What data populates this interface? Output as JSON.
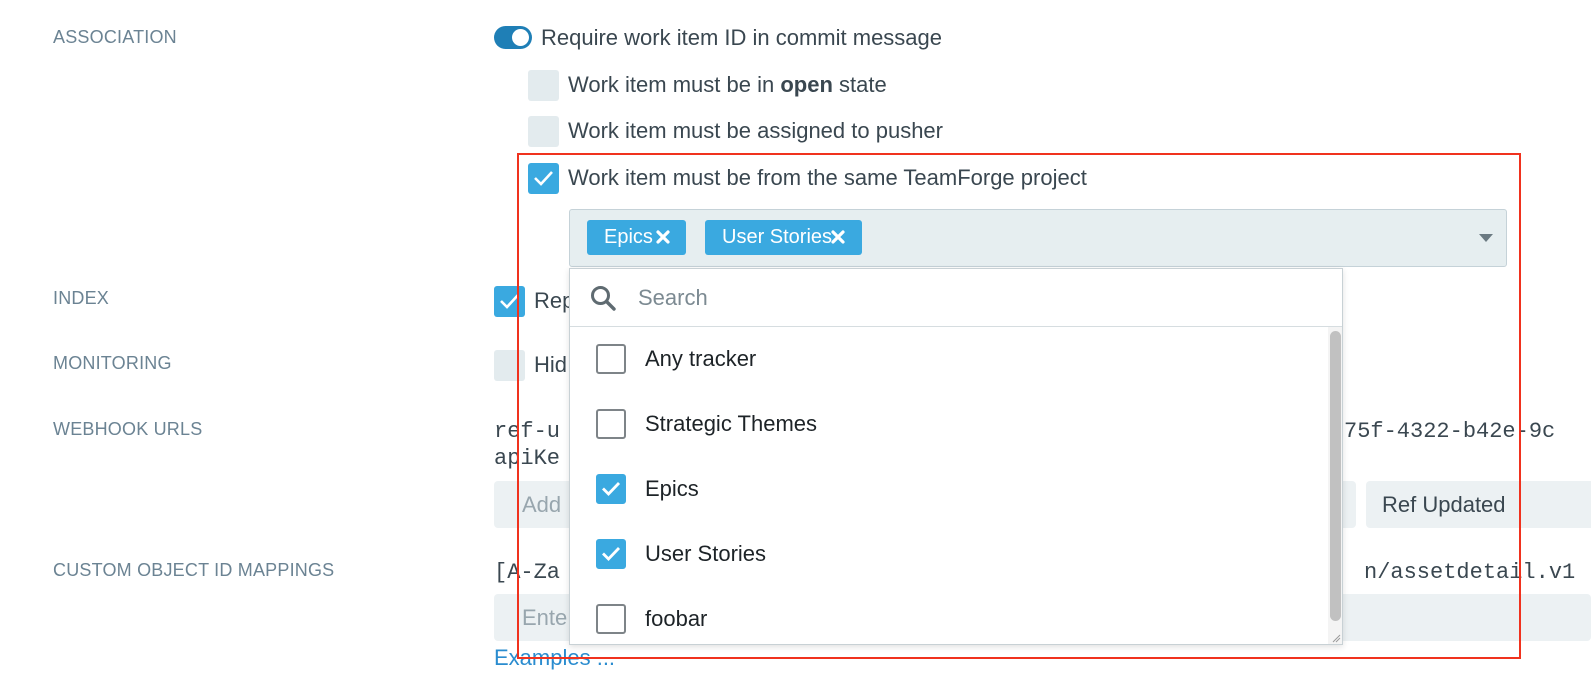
{
  "sections": {
    "association": "ASSOCIATION",
    "index": "INDEX",
    "monitoring": "MONITORING",
    "webhook_urls": "WEBHOOK URLS",
    "custom_mappings": "CUSTOM OBJECT ID MAPPINGS"
  },
  "association": {
    "require_id_toggle_on": true,
    "require_id_label": "Require work item ID in commit message",
    "open_state": {
      "checked": false,
      "prefix": "Work item must be in ",
      "bold": "open",
      "suffix": " state"
    },
    "assigned_to_pusher": {
      "checked": false,
      "label": "Work item must be assigned to pusher"
    },
    "same_project": {
      "checked": true,
      "label": "Work item must be from the same TeamForge project"
    }
  },
  "tracker_select": {
    "selected_tags": [
      "Epics",
      "User Stories"
    ],
    "search_placeholder": "Search",
    "options": [
      {
        "label": "Any tracker",
        "checked": false
      },
      {
        "label": "Strategic Themes",
        "checked": false
      },
      {
        "label": "Epics",
        "checked": true
      },
      {
        "label": "User Stories",
        "checked": true
      },
      {
        "label": "foobar",
        "checked": false
      }
    ]
  },
  "index": {
    "checked": true,
    "label_partial": "Rep"
  },
  "monitoring": {
    "checked": false,
    "label_partial": "Hid"
  },
  "webhook": {
    "url_line1_left": "ref-u",
    "url_line1_right": "75f-4322-b42e-9c",
    "url_line2_left": "apiKe",
    "add_placeholder_partial": "Add",
    "ref_updated_label": "Ref Updated"
  },
  "custom_mappings": {
    "pattern_left": "[A-Za",
    "pattern_right": "n/assetdetail.v1",
    "enter_placeholder_partial": "Ente",
    "examples_link": "Examples ..."
  },
  "colors": {
    "accent": "#3aa9e0",
    "toggle": "#1f7fb6",
    "highlight_box": "#f0321e",
    "section_label": "#6b8393",
    "link": "#2a8ccf"
  },
  "icons": {
    "search": "search-icon",
    "check": "check-icon",
    "tag_remove": "times-icon",
    "dropdown": "caret-down-icon",
    "resize": "resize-grip-icon"
  }
}
